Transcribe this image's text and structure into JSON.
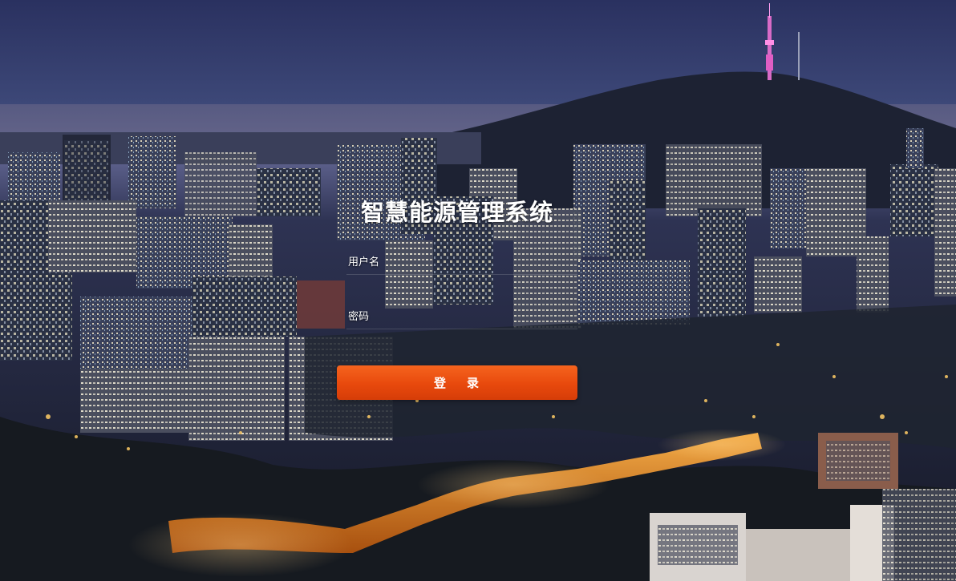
{
  "app": {
    "title": "智慧能源管理系统"
  },
  "form": {
    "username_label": "用户名",
    "username_value": "",
    "password_label": "密码",
    "password_value": "",
    "login_char_1": "登",
    "login_char_2": "录"
  },
  "colors": {
    "accent": "#e8490d",
    "title_text": "#ffffff",
    "sky": "#3b4a7a"
  },
  "background": {
    "icon": "city-night-skyline-image"
  }
}
